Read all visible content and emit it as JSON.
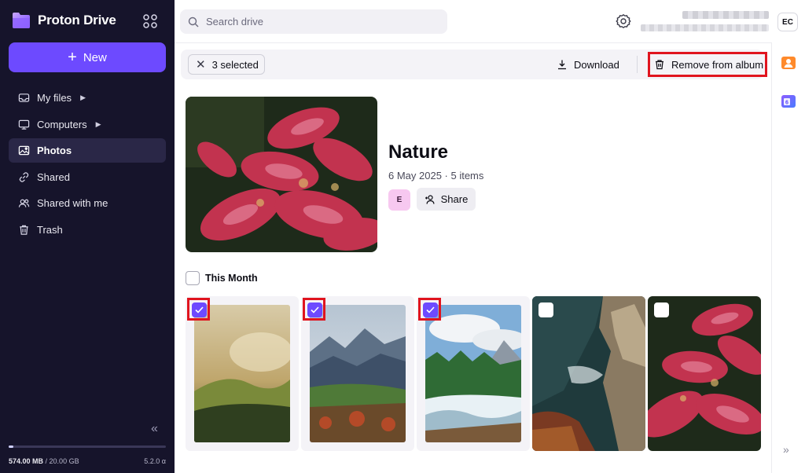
{
  "app": {
    "brand": "Proton Drive",
    "new_button": "New"
  },
  "sidebar": {
    "items": [
      {
        "label": "My files",
        "icon": "inbox-icon",
        "has_caret": true,
        "active": false
      },
      {
        "label": "Computers",
        "icon": "monitor-icon",
        "has_caret": true,
        "active": false
      },
      {
        "label": "Photos",
        "icon": "image-icon",
        "has_caret": false,
        "active": true
      },
      {
        "label": "Shared",
        "icon": "link-icon",
        "has_caret": false,
        "active": false
      },
      {
        "label": "Shared with me",
        "icon": "users-icon",
        "has_caret": false,
        "active": false
      },
      {
        "label": "Trash",
        "icon": "trash-icon",
        "has_caret": false,
        "active": false
      }
    ],
    "storage": {
      "used": "574.00 MB",
      "separator": " / ",
      "total": "20.00 GB",
      "used_fraction": 0.028
    },
    "version": "5.2.0 α"
  },
  "header": {
    "search_placeholder": "Search drive",
    "avatar_initials": "EC"
  },
  "toolbar": {
    "selected_label": "3 selected",
    "download_label": "Download",
    "remove_label": "Remove from album"
  },
  "album": {
    "title": "Nature",
    "meta": "6 May 2025 · 5 items",
    "member_initial": "E",
    "share_label": "Share"
  },
  "section": {
    "title": "This Month"
  },
  "photos": [
    {
      "subject": "misty-sunrise-hills",
      "selected": true
    },
    {
      "subject": "mountain-valley",
      "selected": true
    },
    {
      "subject": "river-rapids-forest",
      "selected": true
    },
    {
      "subject": "rocky-coast-water",
      "selected": false
    },
    {
      "subject": "red-coleus-leaves",
      "selected": false
    }
  ],
  "colors": {
    "sidebar_bg": "#16142b",
    "accent": "#6d4aff",
    "highlight_red": "#e0141e"
  }
}
